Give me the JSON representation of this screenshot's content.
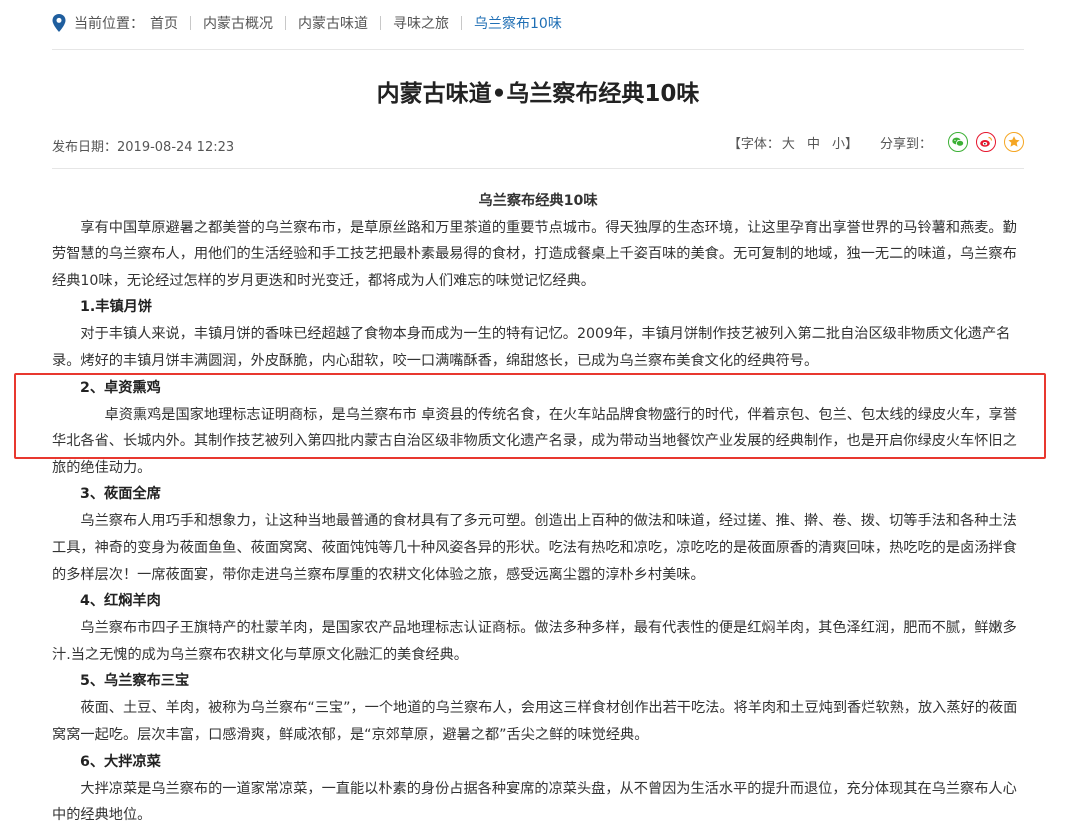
{
  "breadcrumb": {
    "label": "当前位置：",
    "items": [
      "首页",
      "内蒙古概况",
      "内蒙古味道",
      "寻味之旅",
      "乌兰察布10味"
    ]
  },
  "article": {
    "title": "内蒙古味道•乌兰察布经典10味",
    "date": "发布日期：2019-08-24 12:23",
    "font_label": "【字体：",
    "font_sizes": [
      "大",
      "中",
      "小"
    ],
    "font_close": "】",
    "share_label": "分享到：",
    "subhead": "乌兰察布经典10味",
    "intro": "享有中国草原避暑之都美誉的乌兰察布市，是草原丝路和万里茶道的重要节点城市。得天独厚的生态环境，让这里孕育出享誉世界的马铃薯和燕麦。勤劳智慧的乌兰察布人，用他们的生活经验和手工技艺把最朴素最易得的食材，打造成餐桌上千姿百味的美食。无可复制的地域，独一无二的味道，乌兰察布经典10味，无论经过怎样的岁月更迭和时光变迁，都将成为人们难忘的味觉记忆经典。",
    "sections": [
      {
        "heading": "1.丰镇月饼",
        "body": "对于丰镇人来说，丰镇月饼的香味已经超越了食物本身而成为一生的特有记忆。2009年，丰镇月饼制作技艺被列入第二批自治区级非物质文化遗产名录。烤好的丰镇月饼丰满圆润，外皮酥脆，内心甜软，咬一口满嘴酥香，绵甜悠长，已成为乌兰察布美食文化的经典符号。"
      },
      {
        "heading": "2、卓资熏鸡",
        "body": "卓资熏鸡是国家地理标志证明商标，是乌兰察布市 卓资县的传统名食，在火车站品牌食物盛行的时代，伴着京包、包兰、包太线的绿皮火车，享誉华北各省、长城内外。其制作技艺被列入第四批内蒙古自治区级非物质文化遗产名录，成为带动当地餐饮产业发展的经典制作，也是开启你绿皮火车怀旧之旅的绝佳动力。"
      },
      {
        "heading": "3、莜面全席",
        "body": "乌兰察布人用巧手和想象力，让这种当地最普通的食材具有了多元可塑。创造出上百种的做法和味道，经过搓、推、擀、卷、拨、切等手法和各种土法工具，神奇的变身为莜面鱼鱼、莜面窝窝、莜面饨饨等几十种风姿各异的形状。吃法有热吃和凉吃，凉吃吃的是莜面原香的清爽回味，热吃吃的是卤汤拌食的多样层次！一席莜面宴，带你走进乌兰察布厚重的农耕文化体验之旅，感受远离尘嚣的淳朴乡村美味。"
      },
      {
        "heading": "4、红焖羊肉",
        "body": "乌兰察布市四子王旗特产的杜蒙羊肉，是国家农产品地理标志认证商标。做法多种多样，最有代表性的便是红焖羊肉，其色泽红润，肥而不腻，鲜嫩多汁.当之无愧的成为乌兰察布农耕文化与草原文化融汇的美食经典。"
      },
      {
        "heading": "5、乌兰察布三宝",
        "body": "莜面、土豆、羊肉，被称为乌兰察布“三宝”，一个地道的乌兰察布人，会用这三样食材创作出若干吃法。将羊肉和土豆炖到香烂软熟，放入蒸好的莜面窝窝一起吃。层次丰富，口感滑爽，鲜咸浓郁，是“京郊草原，避暑之都”舌尖之鲜的味觉经典。"
      },
      {
        "heading": "6、大拌凉菜",
        "body": "大拌凉菜是乌兰察布的一道家常凉菜，一直能以朴素的身份占据各种宴席的凉菜头盘，从不曾因为生活水平的提升而退位，充分体现其在乌兰察布人心中的经典地位。"
      }
    ]
  },
  "icons": {
    "location": "location-pin-icon",
    "wechat": "wechat-icon",
    "weibo": "weibo-icon",
    "favorite": "star-icon"
  },
  "colors": {
    "link_active": "#1f6fb5",
    "wechat": "#3cb035",
    "weibo": "#e6162d",
    "favorite": "#f5a623",
    "highlight_box": "#e8382f"
  }
}
